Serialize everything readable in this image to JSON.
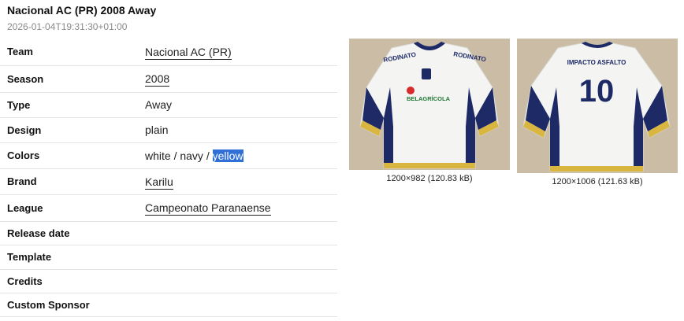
{
  "page": {
    "title": "Nacional AC (PR) 2008 Away",
    "timestamp": "2026-01-04T19:31:30+01:00"
  },
  "rows": [
    {
      "label": "Team",
      "value": "Nacional AC (PR)"
    },
    {
      "label": "Season",
      "value": "2008"
    },
    {
      "label": "Type",
      "value": "Away"
    },
    {
      "label": "Design",
      "value": "plain"
    },
    {
      "label": "Colors",
      "parts": [
        "white",
        "navy",
        "yellow"
      ],
      "sep": " / "
    },
    {
      "label": "Brand",
      "value": "Karilu"
    },
    {
      "label": "League",
      "value": "Campeonato Paranaense"
    },
    {
      "label": "Release date",
      "value": ""
    },
    {
      "label": "Template",
      "value": ""
    },
    {
      "label": "Credits",
      "value": ""
    },
    {
      "label": "Custom Sponsor",
      "value": ""
    }
  ],
  "images": [
    {
      "caption": "1200×982 (120.83 kB)",
      "sponsor_top": "RODINATO",
      "sponsor_chest": "BELAGRÍCOLA"
    },
    {
      "caption": "1200×1006 (121.63 kB)",
      "name": "IMPACTO ASFALTO",
      "number": "10"
    }
  ],
  "colors": {
    "shirt": "#f4f4f2",
    "navy": "#1d2a66",
    "yellow": "#d9b640",
    "green": "#1f7a35",
    "highlight": "#2f6fd6"
  }
}
